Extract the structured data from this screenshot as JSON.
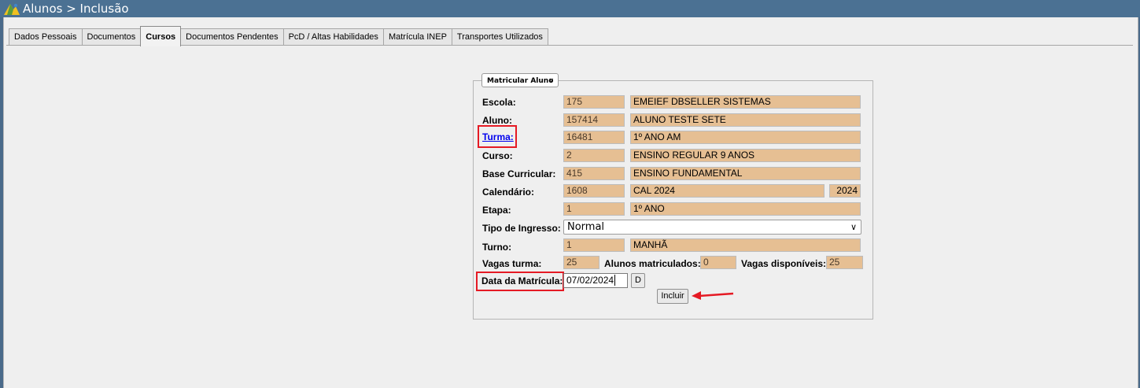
{
  "window": {
    "title": "Alunos > Inclusão"
  },
  "tabs": [
    {
      "label": "Dados Pessoais",
      "active": false
    },
    {
      "label": "Documentos",
      "active": false
    },
    {
      "label": "Cursos",
      "active": true
    },
    {
      "label": "Documentos Pendentes",
      "active": false
    },
    {
      "label": "PcD / Altas Habilidades",
      "active": false
    },
    {
      "label": "Matrícula INEP",
      "active": false
    },
    {
      "label": "Transportes Utilizados",
      "active": false
    }
  ],
  "form": {
    "legend": "Matricular Aluno",
    "labels": {
      "escola": "Escola:",
      "aluno": "Aluno:",
      "turma": "Turma:",
      "curso": "Curso:",
      "base": "Base Curricular:",
      "calendario": "Calendário:",
      "etapa": "Etapa:",
      "tipo_ingresso": "Tipo de Ingresso:",
      "turno": "Turno:",
      "vagas_turma": "Vagas turma:",
      "alunos_matriculados": "Alunos matriculados:",
      "vagas_disponiveis": "Vagas disponíveis:",
      "data_matricula": "Data da Matrícula:"
    },
    "values": {
      "escola_code": "175",
      "escola_name": "EMEIEF DBSELLER SISTEMAS",
      "aluno_code": "157414",
      "aluno_name": "ALUNO TESTE SETE",
      "turma_code": "16481",
      "turma_name": "1º ANO AM",
      "curso_code": "2",
      "curso_name": "ENSINO REGULAR 9 ANOS",
      "base_code": "415",
      "base_name": "ENSINO FUNDAMENTAL",
      "calendario_code": "1608",
      "calendario_name": "CAL 2024",
      "calendario_year": "2024",
      "etapa_code": "1",
      "etapa_name": "1º ANO",
      "tipo_ingresso": "Normal",
      "turno_code": "1",
      "turno_name": "MANHÃ",
      "vagas_turma": "25",
      "alunos_matriculados": "0",
      "vagas_disponiveis": "25",
      "data_matricula": "07/02/2024"
    },
    "date_button": "D",
    "submit_button": "Incluir"
  }
}
